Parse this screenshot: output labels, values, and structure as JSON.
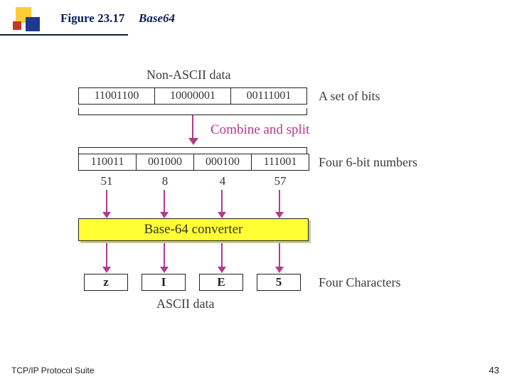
{
  "figure": {
    "number": "Figure 23.17",
    "title": "Base64"
  },
  "labels": {
    "non_ascii": "Non-ASCII data",
    "set_of_bits": "A set of bits",
    "combine": "Combine and split",
    "four6": "Four 6-bit numbers",
    "converter": "Base-64 converter",
    "four_chars": "Four Characters",
    "ascii": "ASCII data"
  },
  "row_bits8": [
    "11001100",
    "10000001",
    "00111001"
  ],
  "row_bits6": [
    "110011",
    "001000",
    "000100",
    "111001"
  ],
  "row_dec": [
    "51",
    "8",
    "4",
    "57"
  ],
  "row_chars": [
    "z",
    "I",
    "E",
    "5"
  ],
  "footer": {
    "left": "TCP/IP Protocol Suite",
    "page": "43"
  }
}
